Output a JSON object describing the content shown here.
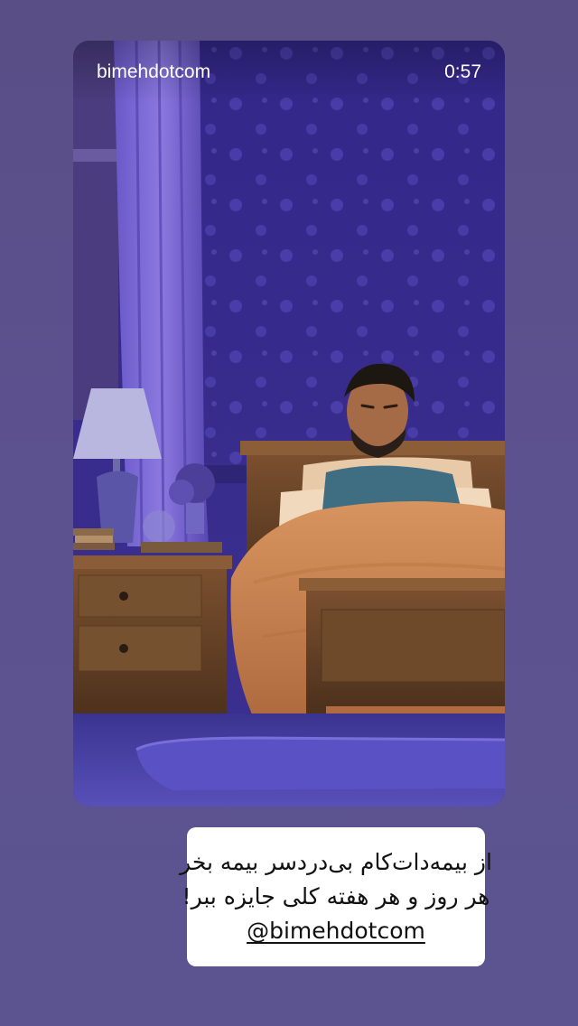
{
  "story": {
    "account_name": "bimehdotcom",
    "timer": "0:57"
  },
  "caption": {
    "line1": "از بیمه‌دات‌کام بی‌دردسر بیمه بخر",
    "line2": "هر روز و هر هفته کلی جایزه ببر!",
    "mention": "@bimehdotcom"
  },
  "colors": {
    "background": "#5b5290",
    "wallpaper": "#3a2f86",
    "caption_bg": "#ffffff"
  }
}
